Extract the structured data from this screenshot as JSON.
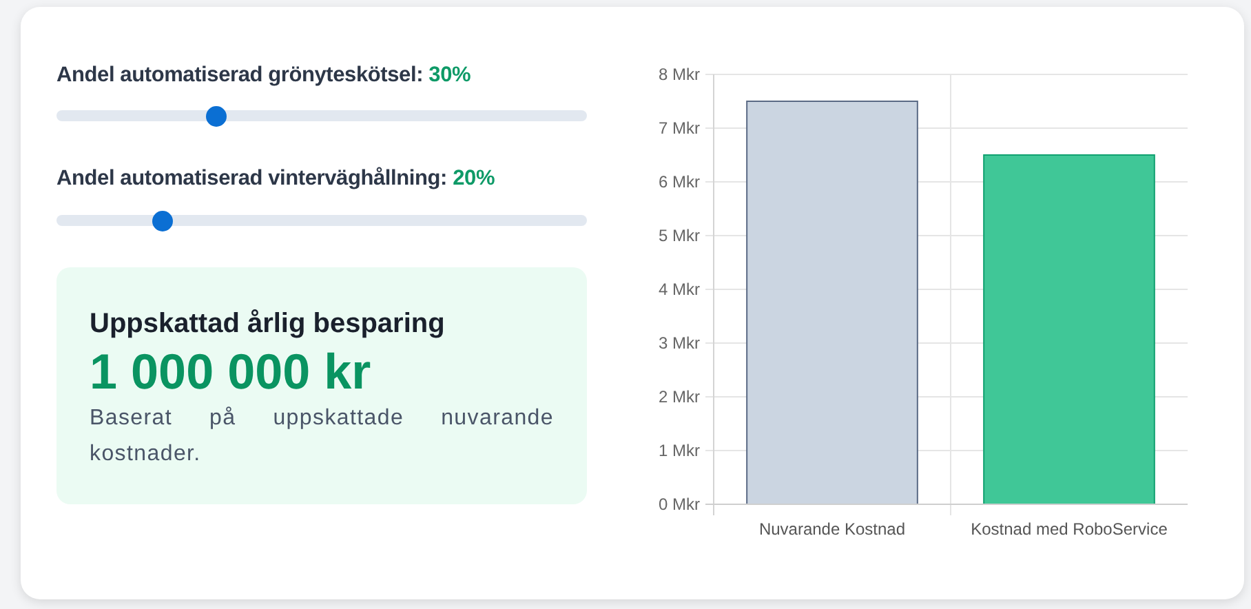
{
  "sliders": [
    {
      "label": "Andel automatiserad grönyteskötsel:",
      "reading": "30%",
      "level": 0.3
    },
    {
      "label": "Andel automatiserad vinterväghållning:",
      "reading": "20%",
      "level": 0.2
    }
  ],
  "savings": {
    "title": "Uppskattad årlig besparing",
    "amount": "1 000 000 kr",
    "note": "Baserat på uppskattade nuvarande kostnader."
  },
  "chart_data": {
    "type": "bar",
    "categories": [
      "Nuvarande Kostnad",
      "Kostnad med RoboService"
    ],
    "stacked": true,
    "grid": true,
    "series": [
      {
        "color": "#cbd5e1",
        "values": [
          7.5,
          null
        ]
      },
      {
        "color": "#40c797",
        "values": [
          null,
          6.5
        ]
      }
    ],
    "ylim": [
      0,
      8
    ],
    "yticks": [
      {
        "value": 0,
        "label": "0 Mkr"
      },
      {
        "value": 1,
        "label": "1 Mkr"
      },
      {
        "value": 2,
        "label": "2 Mkr"
      },
      {
        "value": 3,
        "label": "3 Mkr"
      },
      {
        "value": 4,
        "label": "4 Mkr"
      },
      {
        "value": 5,
        "label": "5 Mkr"
      },
      {
        "value": 6,
        "label": "6 Mkr"
      },
      {
        "value": 7,
        "label": "7 Mkr"
      },
      {
        "value": 8,
        "label": "8 Mkr"
      }
    ]
  }
}
